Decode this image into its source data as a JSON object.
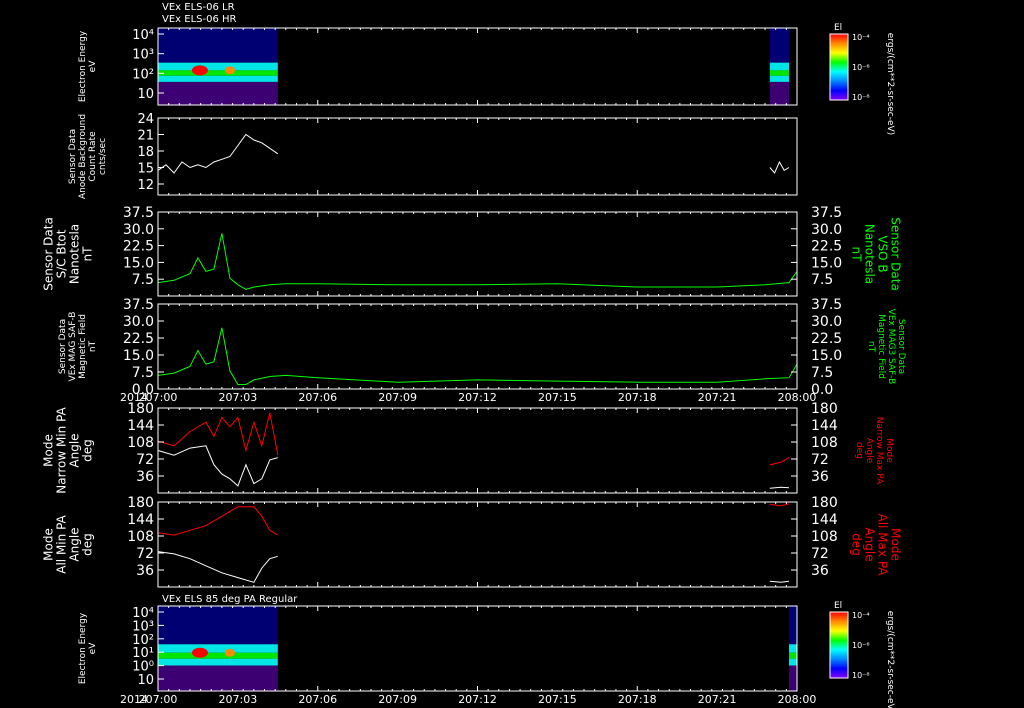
{
  "header": {
    "line1": "VEx ELS-06 LR",
    "line2": "VEx ELS-06 HR",
    "bottom_panel_title": "VEx ELS 85 deg PA Regular"
  },
  "colorbar": {
    "label": "El",
    "ticks": [
      "10⁻⁴",
      "10⁻⁶",
      "10⁻⁸"
    ],
    "ticks_bottom": [
      "10⁻⁴",
      "10⁻⁶",
      "10⁻⁸"
    ],
    "units": "ergs/(cm**2-sr-sec-eV)",
    "colors": [
      "#ff0000",
      "#ff8800",
      "#ffff00",
      "#00ff00",
      "#00ffff",
      "#0088ff",
      "#0000ff",
      "#8800ff"
    ]
  },
  "colors": {
    "white_trace": "#ffffff",
    "green_trace": "#00ff00",
    "red_trace": "#ff0000",
    "axis": "#ffffff"
  },
  "chart_data": [
    {
      "type": "heatmap",
      "id": "electron-energy-top",
      "ylabel": [
        "Electron Energy",
        "eV"
      ],
      "yscale": "log",
      "yticks": [
        "10⁴",
        "10³",
        "10²",
        "10"
      ],
      "data_coverage": [
        [
          207.0,
          207.075
        ],
        [
          207.383,
          207.395
        ]
      ],
      "note_values": "intense band near 10-100 eV"
    },
    {
      "type": "line",
      "id": "anode-background",
      "ylabel": [
        "Sensor Data",
        "Anode Background",
        "Count Rate",
        "cnts/sec"
      ],
      "ylim": [
        10,
        24
      ],
      "yticks": [
        "24",
        "21",
        "18",
        "15",
        "12"
      ],
      "series": [
        {
          "color": "white",
          "segments": [
            {
              "x": [
                207.0,
                207.005,
                207.01,
                207.015,
                207.02,
                207.025,
                207.03,
                207.035,
                207.04,
                207.045,
                207.05,
                207.055,
                207.06,
                207.065,
                207.07,
                207.075
              ],
              "y": [
                14.5,
                15.5,
                14,
                16,
                15,
                15.5,
                15,
                16,
                16.5,
                17,
                19,
                21,
                20,
                19.5,
                18.5,
                17.5
              ]
            },
            {
              "x": [
                207.383,
                207.386,
                207.389,
                207.392,
                207.395
              ],
              "y": [
                15,
                14,
                16,
                14.5,
                15
              ]
            }
          ]
        }
      ]
    },
    {
      "type": "line",
      "id": "bmag-vso",
      "ylabel": [
        "Sensor Data",
        "S/C Btot",
        "Nanotesla",
        "nT"
      ],
      "ylabel_right": [
        "Sensor Data",
        "VSO B",
        "Nanotesla",
        "nT"
      ],
      "ylim": [
        0,
        37.5
      ],
      "yticks": [
        "37.5",
        "30.0",
        "22.5",
        "15.0",
        "7.5"
      ],
      "series": [
        {
          "color": "green",
          "x": [
            207.0,
            207.01,
            207.02,
            207.025,
            207.03,
            207.035,
            207.04,
            207.045,
            207.05,
            207.055,
            207.06,
            207.07,
            207.08,
            207.1,
            207.15,
            207.2,
            207.25,
            207.3,
            207.35,
            207.38,
            207.395,
            207.4
          ],
          "y": [
            6,
            7,
            10,
            17,
            11,
            12,
            28,
            8,
            5,
            3,
            4,
            5,
            5.5,
            5.5,
            5,
            5,
            5.5,
            4,
            4,
            5,
            6,
            11
          ]
        }
      ]
    },
    {
      "type": "line",
      "id": "bmag-saf",
      "ylabel": [
        "Sensor Data",
        "VEx MAG SAF-B",
        "Magnetic Field",
        "nT"
      ],
      "ylabel_right": [
        "Sensor Data",
        "VEx MAG3 SAF-B",
        "Magnetic Field",
        "nT"
      ],
      "ylim": [
        0,
        37.5
      ],
      "yticks": [
        "37.5",
        "30.0",
        "22.5",
        "15.0",
        "7.5",
        "0.0"
      ],
      "series": [
        {
          "color": "green",
          "x": [
            207.0,
            207.01,
            207.02,
            207.025,
            207.03,
            207.035,
            207.04,
            207.045,
            207.05,
            207.055,
            207.06,
            207.07,
            207.08,
            207.1,
            207.15,
            207.2,
            207.25,
            207.3,
            207.35,
            207.38,
            207.395,
            207.4
          ],
          "y": [
            6,
            7,
            10,
            17,
            11,
            12,
            27,
            8,
            2,
            2,
            4,
            5.5,
            6,
            5,
            3,
            4,
            3.5,
            3,
            3,
            4.5,
            5,
            11
          ]
        }
      ]
    },
    {
      "type": "line",
      "id": "narrow-pa",
      "ylabel": [
        "Mode",
        "Narrow Min PA",
        "Angle",
        "deg"
      ],
      "ylabel_right": [
        "Mode",
        "Narrow Max PA",
        "Angle",
        "deg"
      ],
      "ylim": [
        0,
        180
      ],
      "yticks": [
        "180",
        "144",
        "108",
        "72",
        "36"
      ],
      "series": [
        {
          "color": "white",
          "segments": [
            {
              "x": [
                207.0,
                207.01,
                207.02,
                207.03,
                207.035,
                207.04,
                207.045,
                207.05,
                207.055,
                207.06,
                207.065,
                207.07,
                207.075
              ],
              "y": [
                90,
                80,
                95,
                100,
                60,
                40,
                30,
                15,
                60,
                20,
                30,
                70,
                75
              ]
            },
            {
              "x": [
                207.383,
                207.39,
                207.395
              ],
              "y": [
                10,
                12,
                11
              ]
            }
          ]
        },
        {
          "color": "red",
          "segments": [
            {
              "x": [
                207.0,
                207.01,
                207.02,
                207.03,
                207.035,
                207.04,
                207.045,
                207.05,
                207.055,
                207.06,
                207.065,
                207.07,
                207.075
              ],
              "y": [
                110,
                100,
                130,
                150,
                120,
                160,
                140,
                160,
                90,
                150,
                100,
                170,
                80
              ]
            },
            {
              "x": [
                207.383,
                207.39,
                207.395
              ],
              "y": [
                60,
                65,
                75
              ]
            }
          ]
        }
      ]
    },
    {
      "type": "line",
      "id": "all-pa",
      "ylabel": [
        "Mode",
        "All Min PA",
        "Angle",
        "deg"
      ],
      "ylabel_right": [
        "Mode",
        "All Max PA",
        "Angle",
        "deg"
      ],
      "ylim": [
        0,
        180
      ],
      "yticks": [
        "180",
        "144",
        "108",
        "72",
        "36"
      ],
      "series": [
        {
          "color": "white",
          "segments": [
            {
              "x": [
                207.0,
                207.01,
                207.02,
                207.03,
                207.04,
                207.05,
                207.06,
                207.065,
                207.07,
                207.075
              ],
              "y": [
                75,
                70,
                60,
                45,
                30,
                20,
                10,
                40,
                60,
                65
              ]
            },
            {
              "x": [
                207.383,
                207.39,
                207.395
              ],
              "y": [
                12,
                10,
                12
              ]
            }
          ]
        },
        {
          "color": "red",
          "segments": [
            {
              "x": [
                207.0,
                207.01,
                207.02,
                207.03,
                207.04,
                207.05,
                207.06,
                207.065,
                207.07,
                207.075
              ],
              "y": [
                115,
                110,
                120,
                130,
                150,
                170,
                170,
                150,
                120,
                110
              ]
            },
            {
              "x": [
                207.383,
                207.39,
                207.395
              ],
              "y": [
                175,
                172,
                176
              ]
            }
          ]
        }
      ]
    },
    {
      "type": "heatmap",
      "id": "electron-energy-85",
      "ylabel": [
        "Electron Energy",
        "eV"
      ],
      "yscale": "log",
      "yticks": [
        "10⁴",
        "10³",
        "10²",
        "10¹",
        "10⁰",
        "10"
      ],
      "data_coverage": [
        [
          207.0,
          207.075
        ],
        [
          207.395,
          207.4
        ]
      ]
    }
  ],
  "xaxis": {
    "year_label": "2014",
    "ticks": [
      "207:00",
      "207:03",
      "207:06",
      "207:09",
      "207:12",
      "207:15",
      "207:18",
      "207:21",
      "208:00"
    ],
    "range": [
      207.0,
      207.4
    ]
  }
}
